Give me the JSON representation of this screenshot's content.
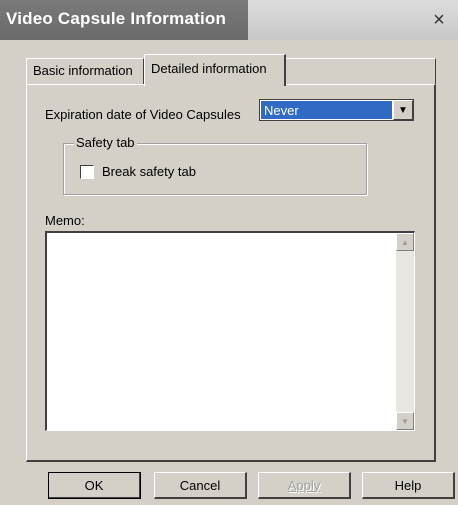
{
  "window": {
    "title": "Video Capsule Information",
    "close_glyph": "×"
  },
  "tabs": [
    {
      "label": "Basic information",
      "selected": false
    },
    {
      "label": "Detailed information",
      "selected": true
    }
  ],
  "expiration": {
    "label": "Expiration date of Video Capsules",
    "value": "Never",
    "arrow_glyph": "▼"
  },
  "safety": {
    "group_label": "Safety tab",
    "checkbox_label": "Break safety tab",
    "checked": false
  },
  "memo": {
    "label": "Memo:",
    "value": "",
    "scroll_up_glyph": "▲",
    "scroll_down_glyph": "▼"
  },
  "buttons": {
    "ok": "OK",
    "cancel": "Cancel",
    "apply": "Apply",
    "help": "Help"
  },
  "colors": {
    "selection": "#316ac5",
    "dialog_face": "#d4d0c8"
  }
}
